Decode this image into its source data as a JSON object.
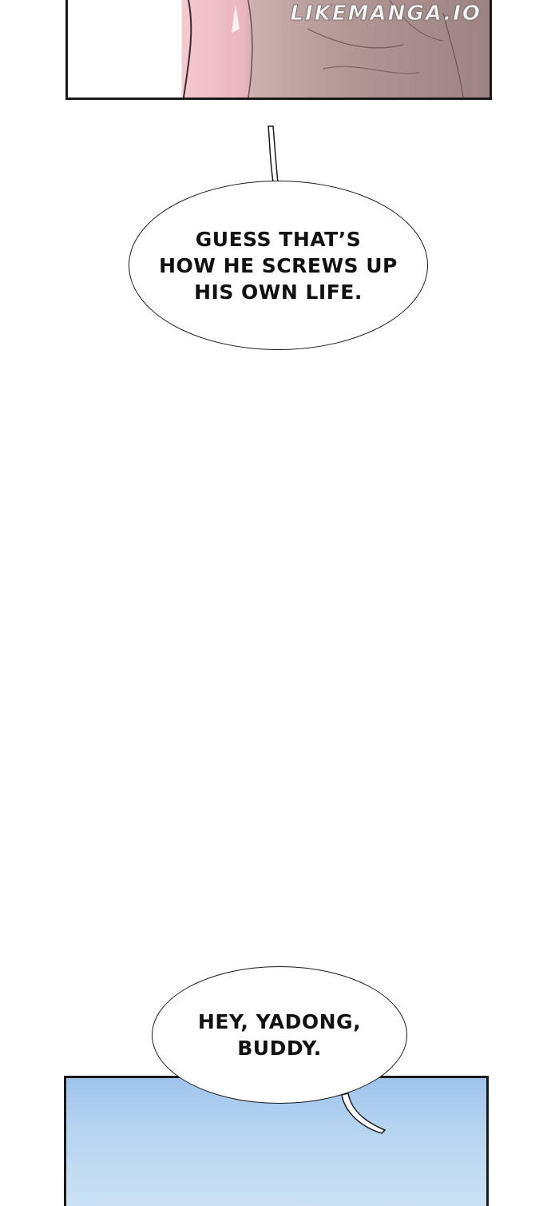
{
  "watermark": "LIKEMANGA.IO",
  "bubbles": [
    {
      "text": "GUESS THAT’S\nHOW HE SCREWS UP\nHIS OWN LIFE."
    },
    {
      "text": "HEY, YADONG,\nBUDDY."
    }
  ],
  "colors": {
    "panel_border": "#1a1a1a",
    "skin_pink": "#eab6bd",
    "fabric_mauve": "#a88e8c",
    "sky_blue": "#b4d3f0"
  }
}
